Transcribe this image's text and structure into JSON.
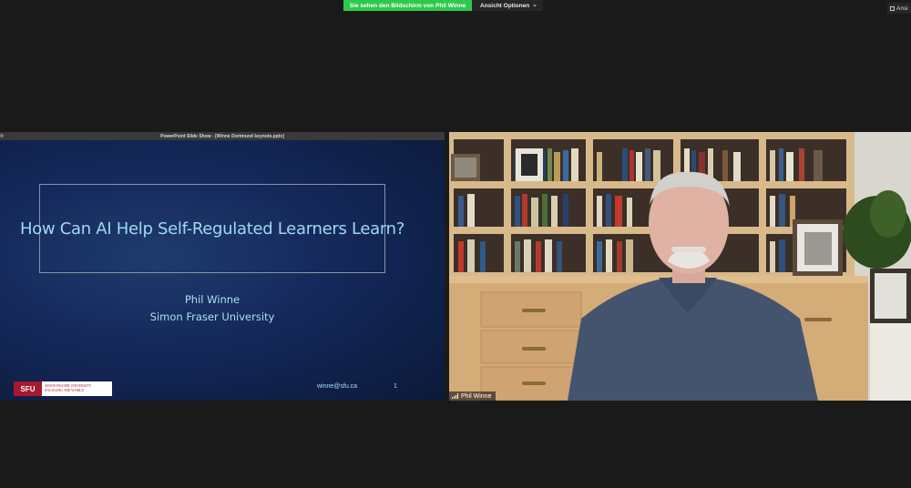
{
  "topbar": {
    "share_banner": "Sie sehen den Bildschirm von Phil Winne",
    "view_options": "Ansicht Optionen",
    "view_button": "Ansi",
    "icons": [
      "chevron-down-icon",
      "grid-view-icon"
    ]
  },
  "slide": {
    "window_title": "PowerPoint Slide Show - [Winne Dortmund keynote.pptx]",
    "title": "How Can AI Help Self-Regulated Learners Learn?",
    "presenter": "Phil Winne",
    "affiliation": "Simon Fraser University",
    "email": "winne@sfu.ca",
    "page_number": "1",
    "logo": {
      "mark": "SFU",
      "line1": "SIMON FRASER UNIVERSITY",
      "line2": "ENGAGING THE WORLD"
    }
  },
  "video": {
    "participant_name": "Phil Winne"
  },
  "colors": {
    "share_green": "#2ec94b",
    "slide_bg": "#14285a",
    "slide_text": "#9fd8f0",
    "sfu_red": "#a6192e"
  }
}
